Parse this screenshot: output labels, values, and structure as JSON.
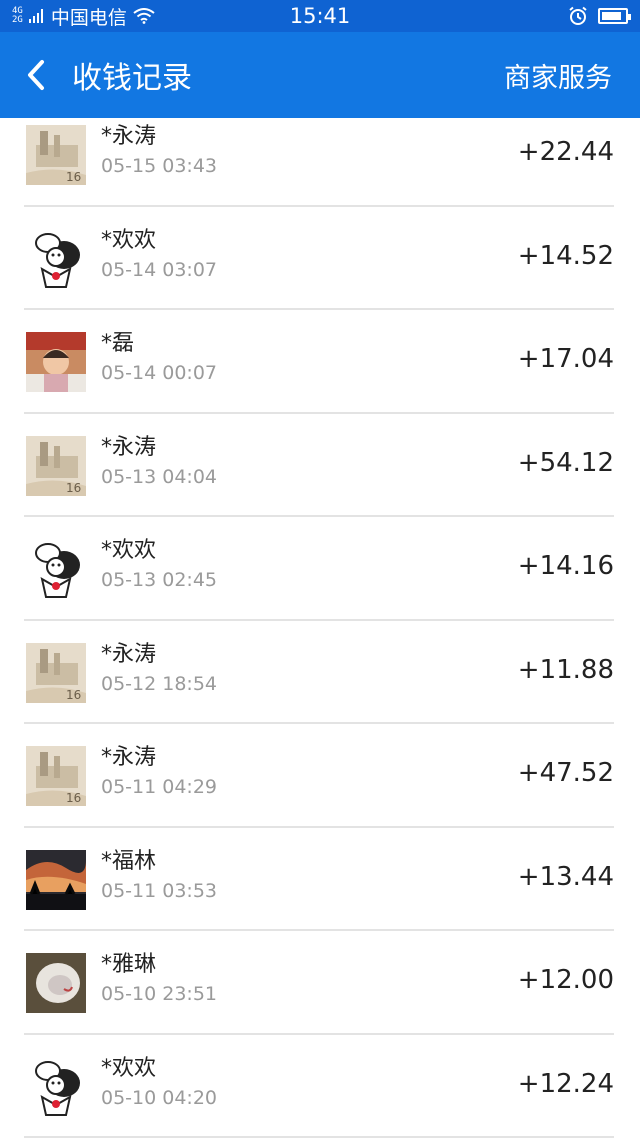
{
  "status_bar": {
    "network_type": "4G",
    "carrier": "中国电信",
    "time": "15:41",
    "battery_level": 0.85
  },
  "nav": {
    "title": "收钱记录",
    "right_label": "商家服务"
  },
  "records": [
    {
      "name": "*永涛",
      "time": "05-15 03:43",
      "amount": "+22.44",
      "avatar": "yongtao"
    },
    {
      "name": "*欢欢",
      "time": "05-14 03:07",
      "amount": "+14.52",
      "avatar": "huanhuan"
    },
    {
      "name": "*磊",
      "time": "05-14 00:07",
      "amount": "+17.04",
      "avatar": "lei"
    },
    {
      "name": "*永涛",
      "time": "05-13 04:04",
      "amount": "+54.12",
      "avatar": "yongtao"
    },
    {
      "name": "*欢欢",
      "time": "05-13 02:45",
      "amount": "+14.16",
      "avatar": "huanhuan"
    },
    {
      "name": "*永涛",
      "time": "05-12 18:54",
      "amount": "+11.88",
      "avatar": "yongtao"
    },
    {
      "name": "*永涛",
      "time": "05-11 04:29",
      "amount": "+47.52",
      "avatar": "yongtao"
    },
    {
      "name": "*福林",
      "time": "05-11 03:53",
      "amount": "+13.44",
      "avatar": "fulin"
    },
    {
      "name": "*雅琳",
      "time": "05-10 23:51",
      "amount": "+12.00",
      "avatar": "yalin"
    },
    {
      "name": "*欢欢",
      "time": "05-10 04:20",
      "amount": "+12.24",
      "avatar": "huanhuan"
    }
  ],
  "colors": {
    "status_bar_bg": "#0f63d2",
    "nav_bg": "#1277e2",
    "divider": "#e3e3e3",
    "time_text": "#9a9a9a"
  }
}
